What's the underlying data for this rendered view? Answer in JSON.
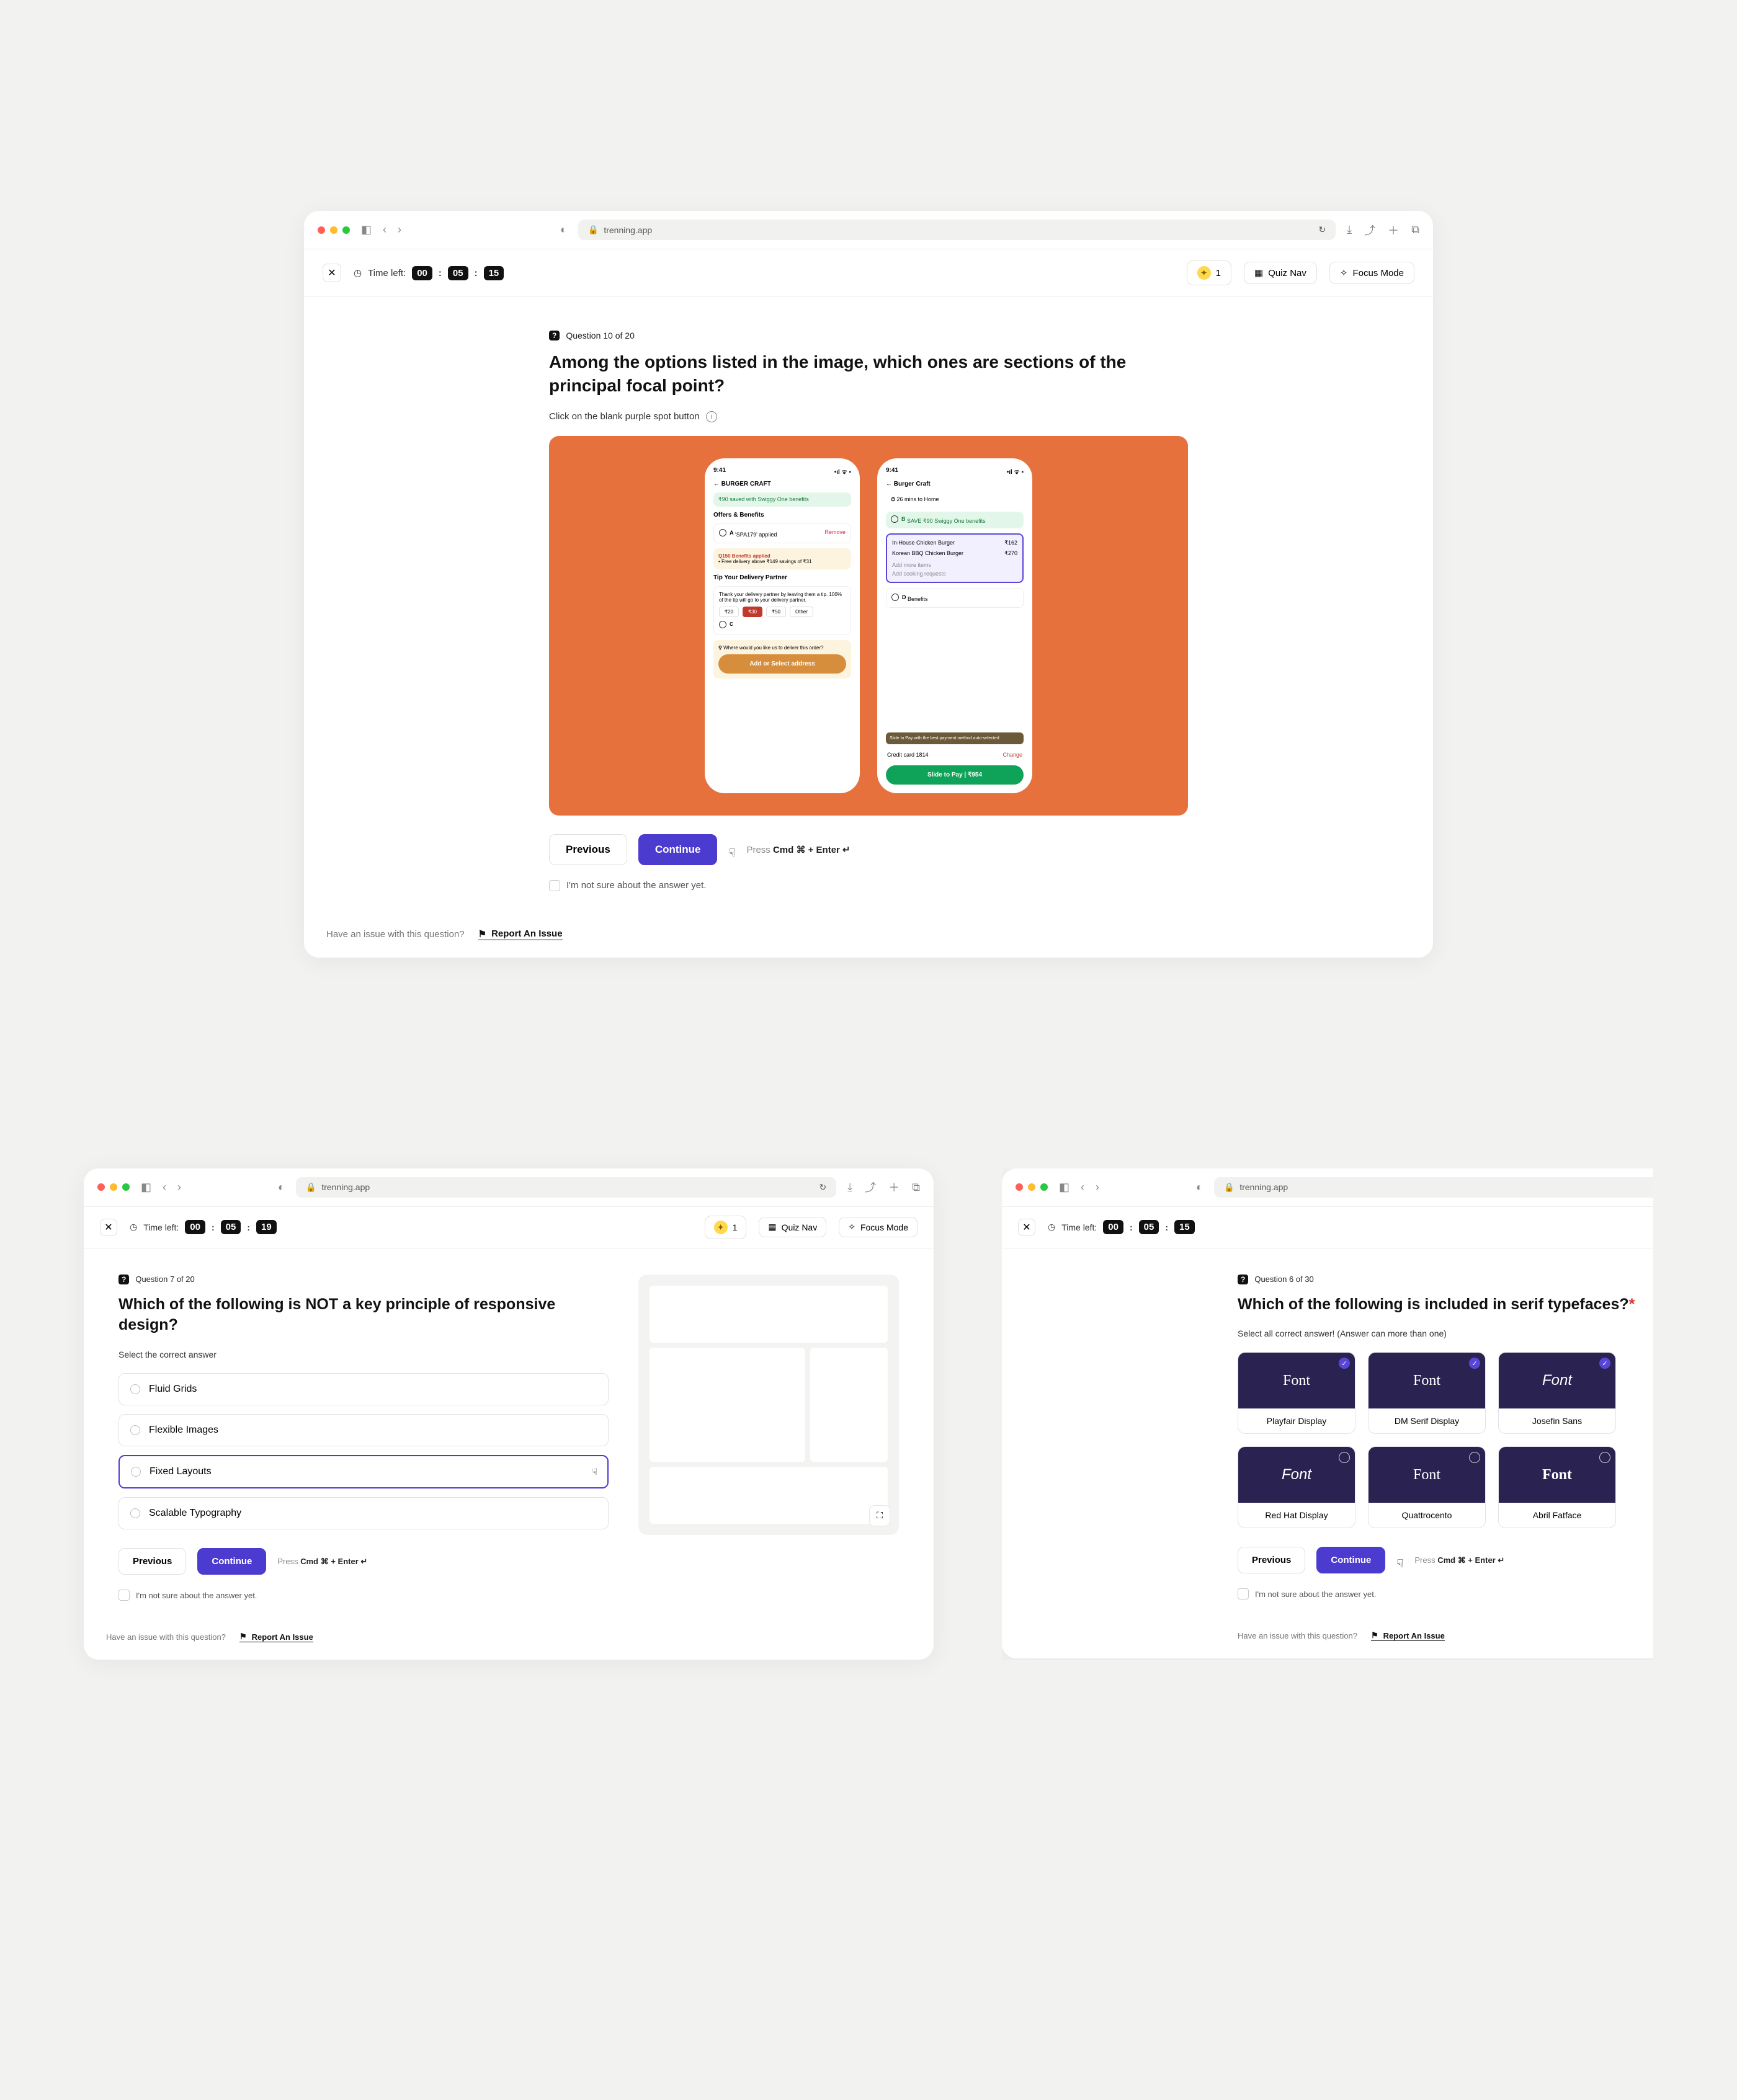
{
  "chrome": {
    "url": "trenning.app"
  },
  "header": {
    "close": "✕",
    "time_label": "Time left:",
    "coin_count": "1",
    "quiz_nav": "Quiz Nav",
    "focus_mode": "Focus Mode"
  },
  "actions": {
    "previous": "Previous",
    "continue": "Continue",
    "hint_prefix": "Press ",
    "hint_keys": "Cmd ⌘ + Enter ↵",
    "unsure": "I'm not sure about the answer yet."
  },
  "footer": {
    "prompt": "Have an issue with this question?",
    "link": "Report An Issue"
  },
  "win1": {
    "time": {
      "h": "00",
      "m": "05",
      "s": "15"
    },
    "badge": "?",
    "meta": "Question 10 of 20",
    "title": "Among the options listed in the image, which ones are sections of the principal focal point?",
    "helper": "Click on the blank purple spot button",
    "phone1": {
      "time": "9:41",
      "brand": "BURGER CRAFT",
      "saved": "₹90 saved with Swiggy One benefits",
      "section": "Offers & Benefits",
      "applied": "'SPA179' applied",
      "remove": "Remove",
      "marker_a": "A",
      "yellow_title": "Q150 Benefits applied",
      "yellow_sub": "Free delivery above ₹149 savings of ₹31",
      "tip_label": "Tip Your Delivery Partner",
      "tip_copy": "Thank your delivery partner by leaving them a tip. 100% of the tip will go to your delivery partner.",
      "tips": [
        "₹20",
        "₹30",
        "₹50",
        "Other"
      ],
      "marker_c": "C",
      "deliver_prompt": "Where would you like us to deliver this order?",
      "cta": "Add or Select address"
    },
    "phone2": {
      "time": "9:41",
      "brand": "Burger Craft",
      "eta": "26 mins to Home",
      "marker_b": "B",
      "saved": "SAVE ₹90 Swiggy One benefits",
      "item1": "In-House Chicken Burger",
      "item1_price": "₹162",
      "item2": "Korean BBQ Chicken Burger",
      "item2_price": "₹270",
      "add_more": "Add more items",
      "coupon": "Add cooking requests",
      "marker_d": "D",
      "benefits": "Benefits",
      "pay_hint": "Slide to Pay with the best payment method auto-selected",
      "card": "Credit card     1814",
      "change": "Change",
      "slide": "Slide to Pay | ₹954"
    }
  },
  "win2": {
    "time": {
      "h": "00",
      "m": "05",
      "s": "19"
    },
    "badge": "?",
    "meta": "Question 7 of 20",
    "title": "Which of the following is NOT a key principle of responsive design?",
    "helper": "Select the correct answer",
    "choices": [
      "Fluid Grids",
      "Flexible Images",
      "Fixed Layouts",
      "Scalable Typography"
    ],
    "selected_index": 2
  },
  "win3": {
    "time": {
      "h": "00",
      "m": "05",
      "s": "15"
    },
    "badge": "?",
    "meta": "Question 6 of 30",
    "title": "Which of the following is included in serif typefaces?",
    "helper": "Select all correct answer! (Answer can more than one)",
    "fonts": [
      {
        "label": "Playfair Display",
        "serif": true,
        "checked": true
      },
      {
        "label": "DM Serif Display",
        "serif": true,
        "checked": true
      },
      {
        "label": "Josefin Sans",
        "serif": false,
        "checked": true
      },
      {
        "label": "Red Hat Display",
        "serif": false,
        "checked": false
      },
      {
        "label": "Quattrocento",
        "serif": true,
        "checked": false
      },
      {
        "label": "Abril Fatface",
        "serif": true,
        "checked": false
      }
    ],
    "font_word": "Font"
  }
}
